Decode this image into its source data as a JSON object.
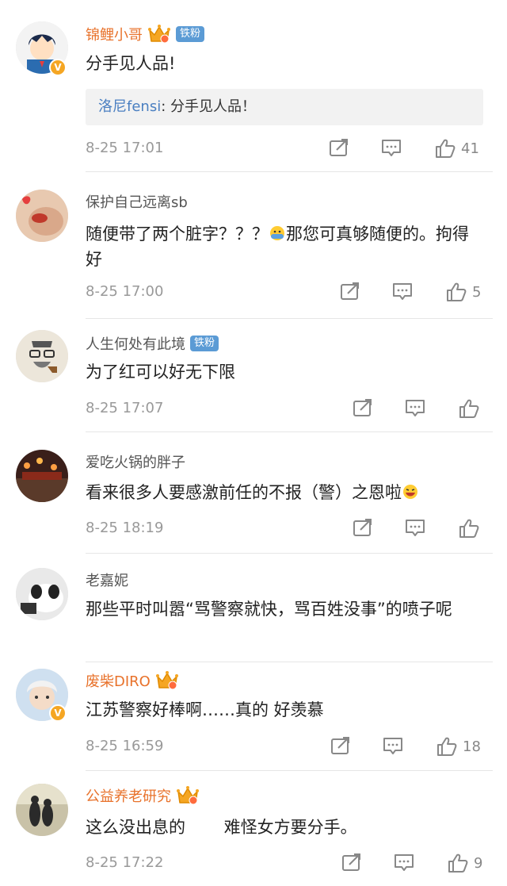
{
  "comments": [
    {
      "username": "锦鲤小哥",
      "badge": "铁粉",
      "content": "分手见人品!",
      "quote": {
        "name": "洛尼fensi",
        "separator": ": ",
        "text": "分手见人品！"
      },
      "time": "8-25 17:01",
      "likes": "41"
    },
    {
      "username": "保护自己远离sb",
      "content_a": "随便带了两个脏字？？？",
      "content_b": "那您可真够随便的。拘得好",
      "time": "8-25 17:00",
      "likes": "5"
    },
    {
      "username": "人生何处有此境",
      "badge": "铁粉",
      "content": "为了红可以好无下限",
      "time": "8-25 17:07",
      "likes": ""
    },
    {
      "username": "爱吃火锅的胖子",
      "content": "看来很多人要感激前任的不报（警）之恩啦",
      "time": "8-25 18:19",
      "likes": ""
    },
    {
      "username": "老嘉妮",
      "content": "那些平时叫嚣“骂警察就快，骂百姓没事”的喷子呢",
      "time": "",
      "likes": ""
    },
    {
      "username": "废柴DIRO",
      "content": "江苏警察好棒啊……真的 好羡慕",
      "time": "8-25 16:59",
      "likes": "18"
    },
    {
      "username": "公益养老研究",
      "content": "这么没出息的　　 难怪女方要分手。",
      "time": "8-25 17:22",
      "likes": "9"
    }
  ],
  "icons": {
    "repost": "repost-icon",
    "comment": "comment-icon",
    "like": "thumbs-up-icon",
    "crown": "crown-badge-icon",
    "verified": "verified-v-icon"
  },
  "colors": {
    "vip_name": "#e8722b",
    "name": "#555555",
    "fan_badge": "#5b9bd5",
    "quote_name": "#4a7fc1",
    "meta": "#999999"
  }
}
